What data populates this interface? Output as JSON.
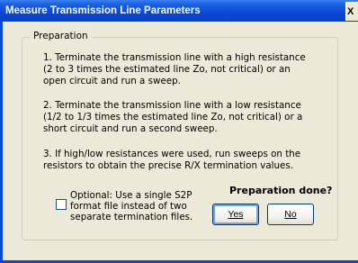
{
  "window": {
    "title": "Measure Transmission Line Parameters",
    "close_glyph": "X"
  },
  "group": {
    "label": "Preparation"
  },
  "instructions": [
    "1. Terminate the transmission line with a high resistance (2 to 3 times the estimated line Zo, not critical) or an open circuit and run a sweep.",
    "2. Terminate the transmission line with a low resistance (1/2 to 1/3 times the estimated line Zo, not critical)  or a short circuit and run a second sweep.",
    "3. If high/low resistances were used, run sweeps on the resistors to obtain the precise R/X termination values."
  ],
  "question": "Preparation done?",
  "option": {
    "label": "Optional:  Use a single S2P format file instead of two separate termination files.",
    "checked": false
  },
  "buttons": {
    "yes_label": "Yes",
    "no_label": "No"
  }
}
